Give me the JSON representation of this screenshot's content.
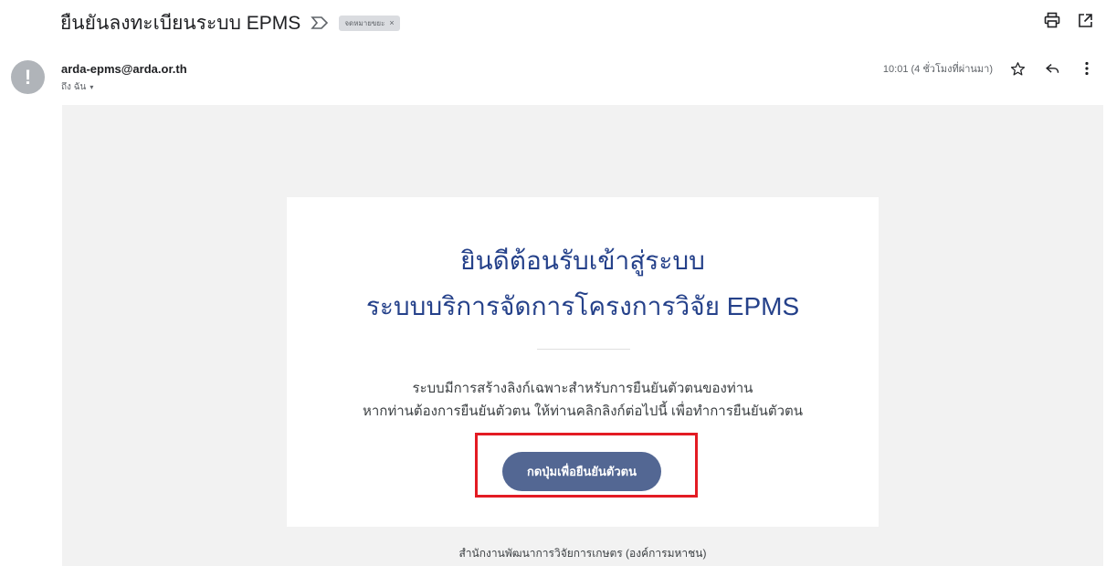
{
  "email": {
    "subject": "ยืนยันลงทะเบียนระบบ EPMS",
    "label_chip": "จดหมายขยะ",
    "label_chip_close": "×",
    "sender": "arda-epms@arda.or.th",
    "to_me": "ถึง ฉัน",
    "to_me_caret": "▾",
    "timestamp": "10:01 (4 ชั่วโมงที่ผ่านมา)",
    "avatar_symbol": "!"
  },
  "card": {
    "welcome_line1": "ยินดีต้อนรับเข้าสู่ระบบ",
    "welcome_line2": "ระบบบริการจัดการโครงการวิจัย EPMS",
    "desc_line1": "ระบบมีการสร้างลิงก์เฉพาะสำหรับการยืนยันตัวตนของท่าน",
    "desc_line2": "หากท่านต้องการยืนยันตัวตน ให้ท่านคลิกลิงก์ต่อไปนี้ เพื่อทำการยืนยันตัวตน",
    "button_label": "กดปุ่มเพื่อยืนยันตัวตน"
  },
  "footer": {
    "org": "สำนักงานพัฒนาการวิจัยการเกษตร (องค์การมหาชน)"
  },
  "colors": {
    "title_blue": "#25418a",
    "button_bg": "#536793",
    "highlight_red": "#e31b23",
    "body_bg": "#f2f2f2"
  },
  "icons": {
    "print": "print-icon",
    "open_new_window": "open-in-new-window-icon",
    "star": "star-icon",
    "reply": "reply-icon",
    "more": "more-vert-icon",
    "importance": "importance-marker-icon"
  }
}
